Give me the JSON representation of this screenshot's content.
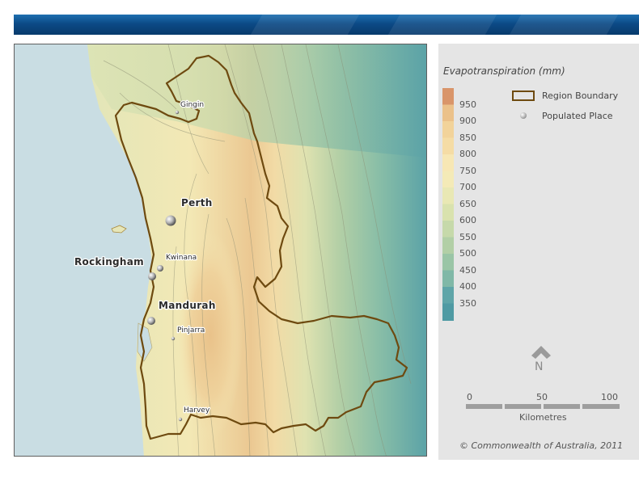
{
  "legend": {
    "title": "Evapotranspiration (mm)",
    "scale": [
      {
        "label": "950",
        "color": "#d9956a"
      },
      {
        "label": "900",
        "color": "#ebc18a"
      },
      {
        "label": "850",
        "color": "#f2d39a"
      },
      {
        "label": "800",
        "color": "#f5dca5"
      },
      {
        "label": "750",
        "color": "#f7e7b4"
      },
      {
        "label": "700",
        "color": "#f4eab7"
      },
      {
        "label": "650",
        "color": "#e9e8b4"
      },
      {
        "label": "600",
        "color": "#d9e2ae"
      },
      {
        "label": "550",
        "color": "#c6d9aa"
      },
      {
        "label": "500",
        "color": "#b2cfa6"
      },
      {
        "label": "450",
        "color": "#9ac5a6"
      },
      {
        "label": "400",
        "color": "#80b8a7"
      },
      {
        "label": "350",
        "color": "#5fa5a8"
      }
    ],
    "bottom_color": "#4f9aa3",
    "region_boundary_label": "Region Boundary",
    "populated_place_label": "Populated Place",
    "north_label": "N",
    "km_ticks": [
      "0",
      "50",
      "100"
    ],
    "km_label": "Kilometres",
    "copyright": "© Commonwealth of Australia, 2011"
  },
  "map": {
    "ocean_color": "#c9dde3",
    "boundary_color": "#6e4a10",
    "places": [
      {
        "name": "Gingin",
        "size": "small"
      },
      {
        "name": "Perth",
        "size": "big"
      },
      {
        "name": "Kwinana",
        "size": "small"
      },
      {
        "name": "Rockingham",
        "size": "big"
      },
      {
        "name": "Mandurah",
        "size": "big"
      },
      {
        "name": "Pinjarra",
        "size": "small"
      },
      {
        "name": "Harvey",
        "size": "small"
      }
    ]
  }
}
